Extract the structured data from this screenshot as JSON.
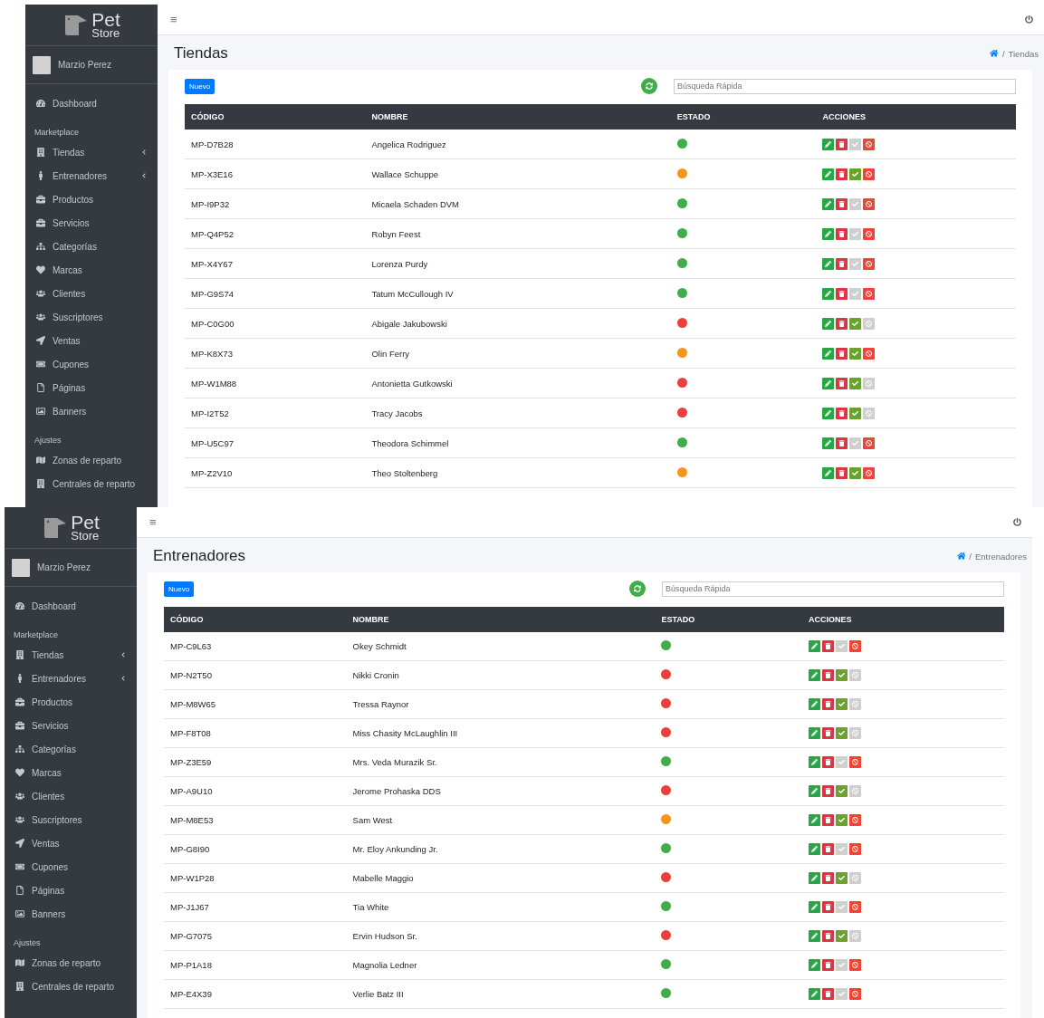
{
  "screens": [
    {
      "topbar": {
        "menu_glyph": "≡"
      },
      "sidebar": {
        "logo": {
          "top": "Pet",
          "bottom": "Store"
        },
        "user": "Marzio Perez",
        "dashboard": "Dashboard",
        "sections": [
          {
            "title": "Marketplace",
            "items": [
              {
                "label": "Tiendas",
                "expandable": true
              },
              {
                "label": "Entrenadores",
                "expandable": true
              },
              {
                "label": "Productos",
                "expandable": false
              },
              {
                "label": "Servicios",
                "expandable": false
              },
              {
                "label": "Categorías",
                "expandable": false
              },
              {
                "label": "Marcas",
                "expandable": false
              },
              {
                "label": "Clientes",
                "expandable": false
              },
              {
                "label": "Suscriptores",
                "expandable": false
              },
              {
                "label": "Ventas",
                "expandable": false
              },
              {
                "label": "Cupones",
                "expandable": false
              },
              {
                "label": "Páginas",
                "expandable": false
              },
              {
                "label": "Banners",
                "expandable": false
              }
            ]
          },
          {
            "title": "Ajustes",
            "items": [
              {
                "label": "Zonas de reparto",
                "expandable": false
              },
              {
                "label": "Centrales de reparto",
                "expandable": false
              }
            ]
          }
        ]
      },
      "page_title": "Tiendas",
      "breadcrumb": {
        "separator": "/",
        "current": "Tiendas"
      },
      "new_button": "Nuevo",
      "search": {
        "placeholder": "Búsqueda Rápida"
      },
      "columns": [
        "CÓDIGO",
        "NOMBRE",
        "ESTADO",
        "ACCIONES"
      ],
      "rows": [
        {
          "code": "MP-D7B28",
          "name": "Angelica Rodriguez",
          "color": "#3fae49",
          "approve_enabled": false,
          "block_enabled": true
        },
        {
          "code": "MP-X3E16",
          "name": "Wallace Schuppe",
          "color": "#f7941d",
          "approve_enabled": true,
          "block_enabled": true
        },
        {
          "code": "MP-I9P32",
          "name": "Micaela Schaden DVM",
          "color": "#3fae49",
          "approve_enabled": false,
          "block_enabled": true
        },
        {
          "code": "MP-Q4P52",
          "name": "Robyn Feest",
          "color": "#3fae49",
          "approve_enabled": false,
          "block_enabled": true
        },
        {
          "code": "MP-X4Y67",
          "name": "Lorenza Purdy",
          "color": "#3fae49",
          "approve_enabled": false,
          "block_enabled": true
        },
        {
          "code": "MP-G9S74",
          "name": "Tatum McCullough IV",
          "color": "#3fae49",
          "approve_enabled": false,
          "block_enabled": true
        },
        {
          "code": "MP-C0G00",
          "name": "Abigale Jakubowski",
          "color": "#e8413b",
          "approve_enabled": true,
          "block_enabled": false
        },
        {
          "code": "MP-K8X73",
          "name": "Olin Ferry",
          "color": "#f7941d",
          "approve_enabled": true,
          "block_enabled": true
        },
        {
          "code": "MP-W1M88",
          "name": "Antonietta Gutkowski",
          "color": "#e8413b",
          "approve_enabled": true,
          "block_enabled": false
        },
        {
          "code": "MP-I2T52",
          "name": "Tracy Jacobs",
          "color": "#e8413b",
          "approve_enabled": true,
          "block_enabled": false
        },
        {
          "code": "MP-U5C97",
          "name": "Theodora Schimmel",
          "color": "#3fae49",
          "approve_enabled": false,
          "block_enabled": true
        },
        {
          "code": "MP-Z2V10",
          "name": "Theo Stoltenberg",
          "color": "#f7941d",
          "approve_enabled": true,
          "block_enabled": true
        }
      ]
    },
    {
      "topbar": {
        "menu_glyph": "≡"
      },
      "sidebar": {
        "logo": {
          "top": "Pet",
          "bottom": "Store"
        },
        "user": "Marzio Perez",
        "dashboard": "Dashboard",
        "sections": [
          {
            "title": "Marketplace",
            "items": [
              {
                "label": "Tiendas",
                "expandable": true
              },
              {
                "label": "Entrenadores",
                "expandable": true
              },
              {
                "label": "Productos",
                "expandable": false
              },
              {
                "label": "Servicios",
                "expandable": false
              },
              {
                "label": "Categorías",
                "expandable": false
              },
              {
                "label": "Marcas",
                "expandable": false
              },
              {
                "label": "Clientes",
                "expandable": false
              },
              {
                "label": "Suscriptores",
                "expandable": false
              },
              {
                "label": "Ventas",
                "expandable": false
              },
              {
                "label": "Cupones",
                "expandable": false
              },
              {
                "label": "Páginas",
                "expandable": false
              },
              {
                "label": "Banners",
                "expandable": false
              }
            ]
          },
          {
            "title": "Ajustes",
            "items": [
              {
                "label": "Zonas de reparto",
                "expandable": false
              },
              {
                "label": "Centrales de reparto",
                "expandable": false
              }
            ]
          }
        ]
      },
      "page_title": "Entrenadores",
      "breadcrumb": {
        "separator": "/",
        "current": "Entrenadores"
      },
      "new_button": "Nuevo",
      "search": {
        "placeholder": "Búsqueda Rápida"
      },
      "columns": [
        "CÓDIGO",
        "NOMBRE",
        "ESTADO",
        "ACCIONES"
      ],
      "rows": [
        {
          "code": "MP-C9L63",
          "name": "Okey Schmidt",
          "color": "#3fae49",
          "approve_enabled": false,
          "block_enabled": true
        },
        {
          "code": "MP-N2T50",
          "name": "Nikki Cronin",
          "color": "#e8413b",
          "approve_enabled": true,
          "block_enabled": false
        },
        {
          "code": "MP-M8W65",
          "name": "Tressa Raynor",
          "color": "#e8413b",
          "approve_enabled": true,
          "block_enabled": false
        },
        {
          "code": "MP-F8T08",
          "name": "Miss Chasity McLaughlin III",
          "color": "#e8413b",
          "approve_enabled": true,
          "block_enabled": false
        },
        {
          "code": "MP-Z3E59",
          "name": "Mrs. Veda Murazik Sr.",
          "color": "#3fae49",
          "approve_enabled": false,
          "block_enabled": true
        },
        {
          "code": "MP-A9U10",
          "name": "Jerome Prohaska DDS",
          "color": "#e8413b",
          "approve_enabled": true,
          "block_enabled": false
        },
        {
          "code": "MP-M8E53",
          "name": "Sam West",
          "color": "#f7941d",
          "approve_enabled": true,
          "block_enabled": true
        },
        {
          "code": "MP-G8I90",
          "name": "Mr. Eloy Ankunding Jr.",
          "color": "#3fae49",
          "approve_enabled": false,
          "block_enabled": true
        },
        {
          "code": "MP-W1P28",
          "name": "Mabelle Maggio",
          "color": "#e8413b",
          "approve_enabled": true,
          "block_enabled": false
        },
        {
          "code": "MP-J1J67",
          "name": "Tia White",
          "color": "#3fae49",
          "approve_enabled": false,
          "block_enabled": true
        },
        {
          "code": "MP-G7075",
          "name": "Ervin Hudson Sr.",
          "color": "#e8413b",
          "approve_enabled": true,
          "block_enabled": false
        },
        {
          "code": "MP-P1A18",
          "name": "Magnolia Ledner",
          "color": "#3fae49",
          "approve_enabled": false,
          "block_enabled": true
        },
        {
          "code": "MP-E4X39",
          "name": "Verlie Batz III",
          "color": "#3fae49",
          "approve_enabled": false,
          "block_enabled": true
        }
      ]
    }
  ]
}
